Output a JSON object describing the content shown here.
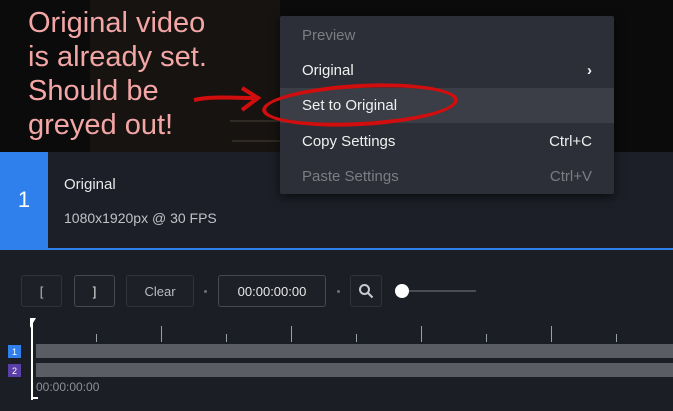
{
  "annotation": {
    "text": "Original video\nis already set.\nShould be\ngreyed out!",
    "color": "#f3a6a6",
    "circle_color": "#d20d0d"
  },
  "context_menu": {
    "items": [
      {
        "label": "Preview",
        "shortcut": "",
        "disabled": true,
        "submenu": false,
        "highlight": false
      },
      {
        "label": "Original",
        "shortcut": "",
        "disabled": false,
        "submenu": true,
        "highlight": false
      },
      {
        "label": "Set to Original",
        "shortcut": "",
        "disabled": false,
        "submenu": false,
        "highlight": true
      },
      {
        "label": "Copy Settings",
        "shortcut": "Ctrl+C",
        "disabled": false,
        "submenu": false,
        "highlight": false
      },
      {
        "label": "Paste Settings",
        "shortcut": "Ctrl+V",
        "disabled": true,
        "submenu": false,
        "highlight": false
      }
    ],
    "submenu_icon": "chevron-right-icon"
  },
  "clip": {
    "index": "1",
    "title": "Original",
    "meta": "1080x1920px @ 30 FPS",
    "accent": "#2f80ed"
  },
  "toolbar": {
    "mark_in": "[",
    "mark_out": "]",
    "clear": "Clear",
    "time": "00:00:00:00",
    "zoom_icon": "search-icon",
    "zoom_level": 0
  },
  "timeline": {
    "tracks": [
      {
        "number": "1",
        "color": "#2f80ed"
      },
      {
        "number": "2",
        "color": "#5b3fa8"
      }
    ],
    "timecode": "00:00:00:00"
  }
}
